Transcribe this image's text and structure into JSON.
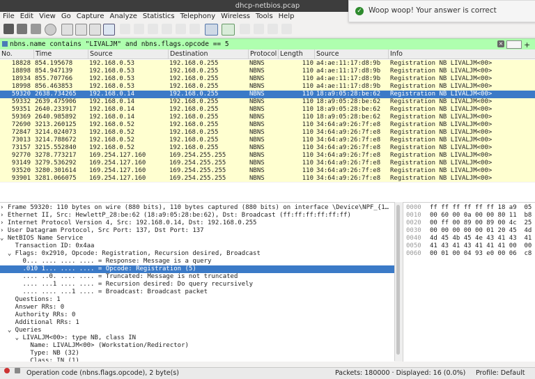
{
  "window": {
    "title": "dhcp-netbios.pcap"
  },
  "menu": [
    "File",
    "Edit",
    "View",
    "Go",
    "Capture",
    "Analyze",
    "Statistics",
    "Telephony",
    "Wireless",
    "Tools",
    "Help"
  ],
  "toast": {
    "message": "Woop woop! Your answer is correct"
  },
  "filter": {
    "value": "nbns.name contains \"LIVALJM\" and nbns.flags.opcode == 5"
  },
  "packet_list": {
    "columns": [
      "No.",
      "Time",
      "Source",
      "Destination",
      "Protocol",
      "Length",
      "Source",
      "Info"
    ],
    "rows": [
      [
        "18828",
        "854.195678",
        "192.168.0.53",
        "192.168.0.255",
        "NBNS",
        "110",
        "a4:ae:11:17:d8:9b",
        "Registration NB LIVALJM<00>"
      ],
      [
        "18898",
        "854.947139",
        "192.168.0.53",
        "192.168.0.255",
        "NBNS",
        "110",
        "a4:ae:11:17:d8:9b",
        "Registration NB LIVALJM<00>"
      ],
      [
        "18934",
        "855.707766",
        "192.168.0.53",
        "192.168.0.255",
        "NBNS",
        "110",
        "a4:ae:11:17:d8:9b",
        "Registration NB LIVALJM<00>"
      ],
      [
        "18998",
        "856.463853",
        "192.168.0.53",
        "192.168.0.255",
        "NBNS",
        "110",
        "a4:ae:11:17:d8:9b",
        "Registration NB LIVALJM<00>"
      ],
      [
        "59320",
        "2638.734265",
        "192.168.0.14",
        "192.168.0.255",
        "NBNS",
        "110",
        "18:a9:05:28:be:62",
        "Registration NB LIVALJM<00>"
      ],
      [
        "59332",
        "2639.475906",
        "192.168.0.14",
        "192.168.0.255",
        "NBNS",
        "110",
        "18:a9:05:28:be:62",
        "Registration NB LIVALJM<00>"
      ],
      [
        "59351",
        "2640.233917",
        "192.168.0.14",
        "192.168.0.255",
        "NBNS",
        "110",
        "18:a9:05:28:be:62",
        "Registration NB LIVALJM<00>"
      ],
      [
        "59369",
        "2640.985892",
        "192.168.0.14",
        "192.168.0.255",
        "NBNS",
        "110",
        "18:a9:05:28:be:62",
        "Registration NB LIVALJM<00>"
      ],
      [
        "72690",
        "3213.260125",
        "192.168.0.52",
        "192.168.0.255",
        "NBNS",
        "110",
        "34:64:a9:26:7f:e8",
        "Registration NB LIVALJM<00>"
      ],
      [
        "72847",
        "3214.024073",
        "192.168.0.52",
        "192.168.0.255",
        "NBNS",
        "110",
        "34:64:a9:26:7f:e8",
        "Registration NB LIVALJM<00>"
      ],
      [
        "73013",
        "3214.788672",
        "192.168.0.52",
        "192.168.0.255",
        "NBNS",
        "110",
        "34:64:a9:26:7f:e8",
        "Registration NB LIVALJM<00>"
      ],
      [
        "73157",
        "3215.552840",
        "192.168.0.52",
        "192.168.0.255",
        "NBNS",
        "110",
        "34:64:a9:26:7f:e8",
        "Registration NB LIVALJM<00>"
      ],
      [
        "92770",
        "3278.773217",
        "169.254.127.160",
        "169.254.255.255",
        "NBNS",
        "110",
        "34:64:a9:26:7f:e8",
        "Registration NB LIVALJM<00>"
      ],
      [
        "93149",
        "3279.536292",
        "169.254.127.160",
        "169.254.255.255",
        "NBNS",
        "110",
        "34:64:a9:26:7f:e8",
        "Registration NB LIVALJM<00>"
      ],
      [
        "93520",
        "3280.301614",
        "169.254.127.160",
        "169.254.255.255",
        "NBNS",
        "110",
        "34:64:a9:26:7f:e8",
        "Registration NB LIVALJM<00>"
      ],
      [
        "93901",
        "3281.066075",
        "169.254.127.160",
        "169.254.255.255",
        "NBNS",
        "110",
        "34:64:a9:26:7f:e8",
        "Registration NB LIVALJM<00>"
      ]
    ],
    "selected_row": 4
  },
  "details": [
    "› Frame 59320: 110 bytes on wire (880 bits), 110 bytes captured (880 bits) on interface \\Device\\NPF_{1…",
    "› Ethernet II, Src: HewlettP_28:be:62 (18:a9:05:28:be:62), Dst: Broadcast (ff:ff:ff:ff:ff:ff)",
    "› Internet Protocol Version 4, Src: 192.168.0.14, Dst: 192.168.0.255",
    "› User Datagram Protocol, Src Port: 137, Dst Port: 137",
    "⌄ NetBIOS Name Service",
    "    Transaction ID: 0x4aa",
    "  ⌄ Flags: 0x2910, Opcode: Registration, Recursion desired, Broadcast",
    "      0... .... .... .... = Response: Message is a query",
    "      .010 1... .... .... = Opcode: Registration (5)",
    "      .... ..0. .... .... = Truncated: Message is not truncated",
    "      .... ...1 .... .... = Recursion desired: Do query recursively",
    "      .... .... ...1 .... = Broadcast: Broadcast packet",
    "    Questions: 1",
    "    Answer RRs: 0",
    "    Authority RRs: 0",
    "    Additional RRs: 1",
    "  ⌄ Queries",
    "    ⌄ LIVALJM<00>: type NB, class IN",
    "        Name: LIVALJM<00> (Workstation/Redirector)",
    "        Type: NB (32)",
    "        Class: IN (1)"
  ],
  "selected_detail": 8,
  "hex": [
    [
      "0000",
      "ff ff ff ff ff ff 18 a9  05"
    ],
    [
      "0010",
      "00 60 00 0a 00 00 80 11  b8"
    ],
    [
      "0020",
      "00 ff 00 89 00 89 00 4c  25"
    ],
    [
      "0030",
      "00 00 00 00 00 01 20 45  4d"
    ],
    [
      "0040",
      "4d 45 4b 45 4e 43 41 43  41"
    ],
    [
      "0050",
      "41 43 41 43 41 41 41 00  00"
    ],
    [
      "0060",
      "00 01 00 04 93 e0 00 06  c8"
    ]
  ],
  "status": {
    "field": "Operation code (nbns.flags.opcode), 2 byte(s)",
    "packets": "Packets: 180000 · Displayed: 16 (0.0%)",
    "profile": "Profile: Default"
  }
}
